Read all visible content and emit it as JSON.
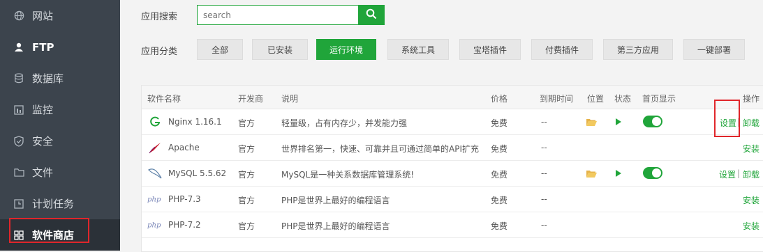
{
  "sidebar": {
    "items": [
      {
        "label": "网站",
        "icon": "globe-icon"
      },
      {
        "label": "FTP",
        "icon": "user-icon"
      },
      {
        "label": "数据库",
        "icon": "database-icon"
      },
      {
        "label": "监控",
        "icon": "monitor-icon"
      },
      {
        "label": "安全",
        "icon": "shield-icon"
      },
      {
        "label": "文件",
        "icon": "folder-icon"
      },
      {
        "label": "计划任务",
        "icon": "clock-icon"
      },
      {
        "label": "软件商店",
        "icon": "grid-icon"
      }
    ]
  },
  "search": {
    "label": "应用搜索",
    "placeholder": "search"
  },
  "categories": {
    "label": "应用分类",
    "items": [
      "全部",
      "已安装",
      "运行环境",
      "系统工具",
      "宝塔插件",
      "付费插件",
      "第三方应用",
      "一键部署"
    ],
    "active": "运行环境"
  },
  "table": {
    "headers": [
      "软件名称",
      "开发商",
      "说明",
      "价格",
      "到期时间",
      "位置",
      "状态",
      "首页显示",
      "操作"
    ],
    "rows": [
      {
        "name": "Nginx 1.16.1",
        "vendor": "官方",
        "desc": "轻量级，占有内存少，并发能力强",
        "price": "免费",
        "expire": "--",
        "op1": "设置",
        "sep": "|",
        "op2": "卸载"
      },
      {
        "name": "Apache",
        "vendor": "官方",
        "desc": "世界排名第一，快速、可靠并且可通过简单的API扩充",
        "price": "免费",
        "expire": "--",
        "op1": "安装"
      },
      {
        "name": "MySQL 5.5.62",
        "vendor": "官方",
        "desc": "MySQL是一种关系数据库管理系统!",
        "price": "免费",
        "expire": "--",
        "op1": "设置",
        "sep": "|",
        "op2": "卸载"
      },
      {
        "name": "PHP-7.3",
        "vendor": "官方",
        "desc": "PHP是世界上最好的编程语言",
        "price": "免费",
        "expire": "--",
        "op1": "安装"
      },
      {
        "name": "PHP-7.2",
        "vendor": "官方",
        "desc": "PHP是世界上最好的编程语言",
        "price": "免费",
        "expire": "--",
        "op1": "安装"
      }
    ]
  },
  "colors": {
    "accent": "#20a53a",
    "sidebar": "#3c444d",
    "highlight": "#e0262b"
  }
}
